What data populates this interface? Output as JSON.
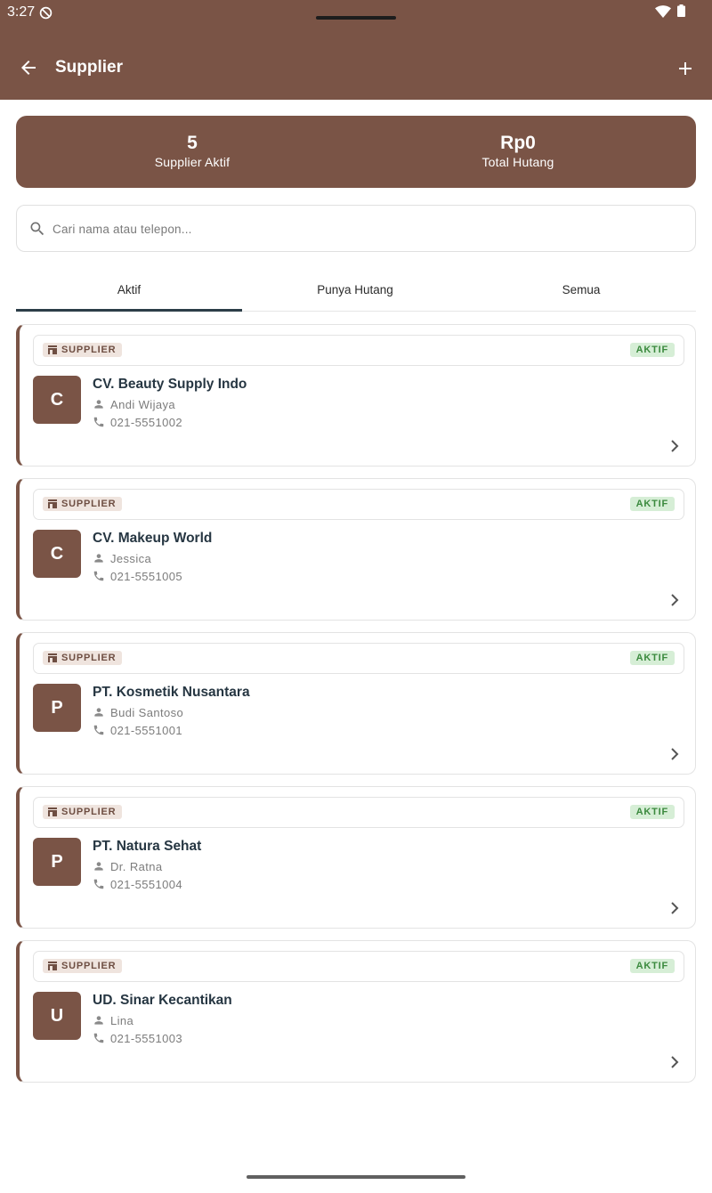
{
  "status_bar": {
    "time": "3:27"
  },
  "app_bar": {
    "title": "Supplier",
    "back_icon": "arrow-back-icon",
    "add_icon": "plus-icon"
  },
  "summary": {
    "active_count": "5",
    "active_label": "Supplier Aktif",
    "debt_total": "Rp0",
    "debt_label": "Total Hutang"
  },
  "search": {
    "placeholder": "Cari nama atau telepon...",
    "value": ""
  },
  "tabs": [
    {
      "label": "Aktif",
      "selected": true
    },
    {
      "label": "Punya Hutang",
      "selected": false
    },
    {
      "label": "Semua",
      "selected": false
    }
  ],
  "suppliers": [
    {
      "type": "SUPPLIER",
      "status": "AKTIF",
      "initial": "C",
      "name": "CV. Beauty Supply Indo",
      "contact": "Andi Wijaya",
      "phone": "021-5551002"
    },
    {
      "type": "SUPPLIER",
      "status": "AKTIF",
      "initial": "C",
      "name": "CV. Makeup World",
      "contact": "Jessica",
      "phone": "021-5551005"
    },
    {
      "type": "SUPPLIER",
      "status": "AKTIF",
      "initial": "P",
      "name": "PT. Kosmetik Nusantara",
      "contact": "Budi Santoso",
      "phone": "021-5551001"
    },
    {
      "type": "SUPPLIER",
      "status": "AKTIF",
      "initial": "P",
      "name": "PT. Natura Sehat",
      "contact": "Dr. Ratna",
      "phone": "021-5551004"
    },
    {
      "type": "SUPPLIER",
      "status": "AKTIF",
      "initial": "U",
      "name": "UD. Sinar Kecantikan",
      "contact": "Lina",
      "phone": "021-5551003"
    }
  ],
  "colors": {
    "brand": "#7a5446",
    "tab_indicator": "#2c3e48",
    "status_active_bg": "#d6eed6",
    "status_active_text": "#3b8a3e"
  }
}
